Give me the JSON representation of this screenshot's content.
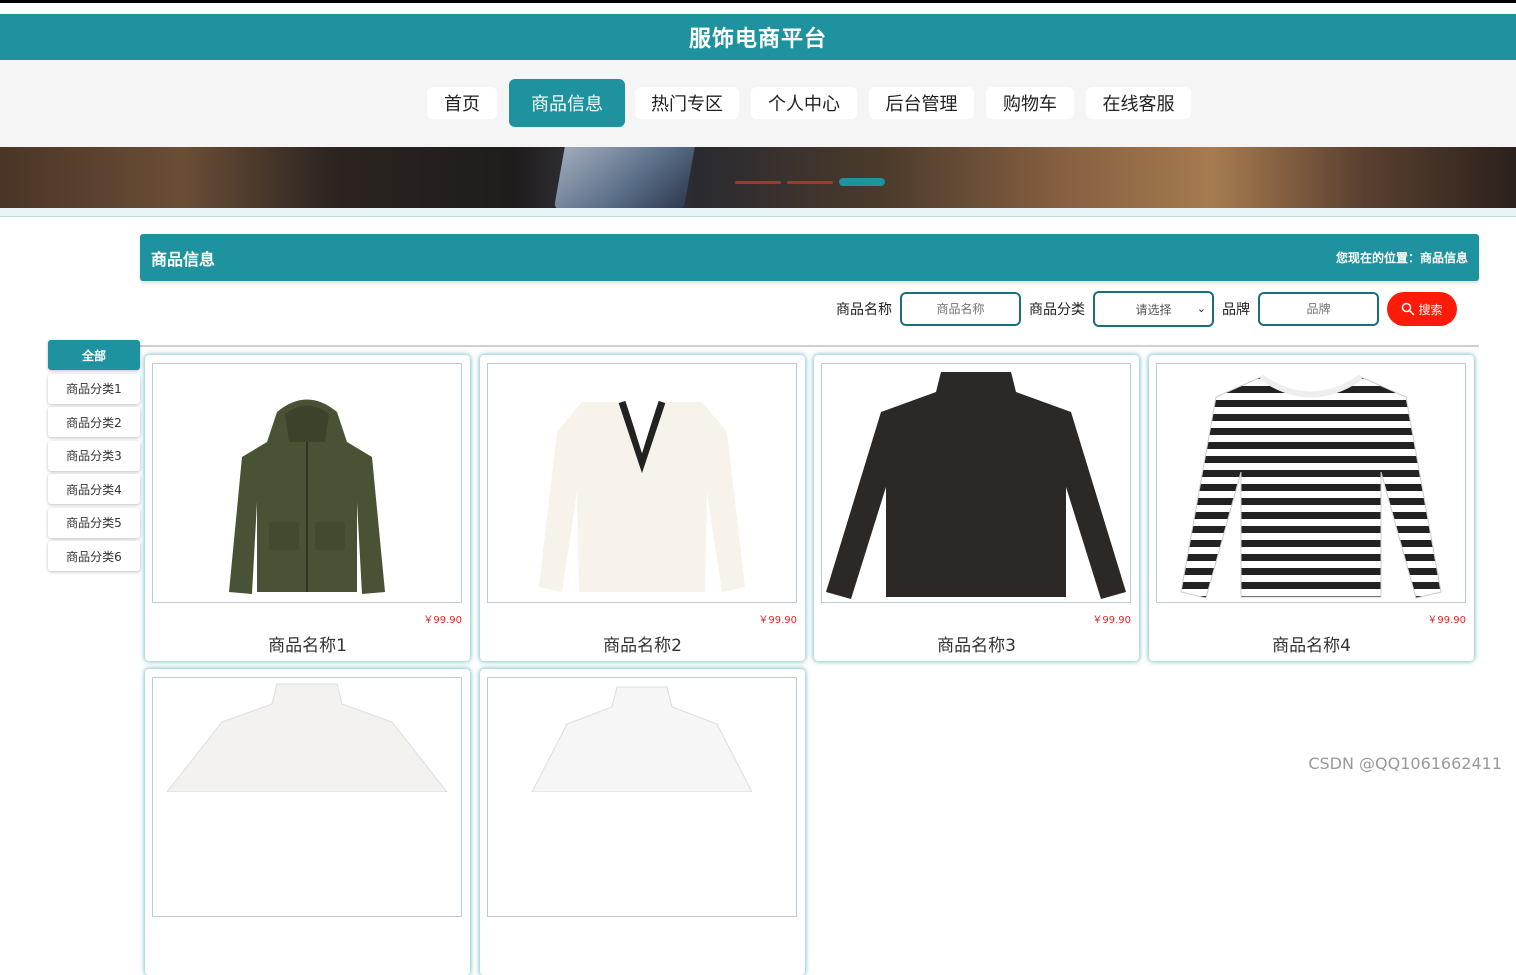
{
  "header": {
    "title": "服饰电商平台"
  },
  "nav": {
    "items": [
      {
        "label": "首页"
      },
      {
        "label": "商品信息",
        "active": true
      },
      {
        "label": "热门专区"
      },
      {
        "label": "个人中心"
      },
      {
        "label": "后台管理"
      },
      {
        "label": "购物车"
      },
      {
        "label": "在线客服"
      }
    ]
  },
  "section": {
    "title": "商品信息",
    "breadcrumb": "您现在的位置：商品信息"
  },
  "search": {
    "name_label": "商品名称",
    "name_placeholder": "商品名称",
    "category_label": "商品分类",
    "category_value": "请选择",
    "brand_label": "品牌",
    "brand_placeholder": "品牌",
    "button_label": "搜索"
  },
  "categories": [
    {
      "label": "全部",
      "active": true
    },
    {
      "label": "商品分类1"
    },
    {
      "label": "商品分类2"
    },
    {
      "label": "商品分类3"
    },
    {
      "label": "商品分类4"
    },
    {
      "label": "商品分类5"
    },
    {
      "label": "商品分类6"
    }
  ],
  "products": [
    {
      "name": "商品名称1",
      "price": "￥99.90",
      "image": "green-jacket"
    },
    {
      "name": "商品名称2",
      "price": "￥99.90",
      "image": "white-v-neck-sweater"
    },
    {
      "name": "商品名称3",
      "price": "￥99.90",
      "image": "black-turtleneck"
    },
    {
      "name": "商品名称4",
      "price": "￥99.90",
      "image": "striped-long-sleeve"
    },
    {
      "name": "",
      "price": "",
      "image": "white-turtleneck"
    },
    {
      "name": "",
      "price": "",
      "image": "white-turtleneck-2"
    }
  ],
  "watermark": "CSDN @QQ1061662411",
  "colors": {
    "primary": "#1e929e",
    "search_button": "#ff1a0a",
    "price": "#ee2222"
  }
}
